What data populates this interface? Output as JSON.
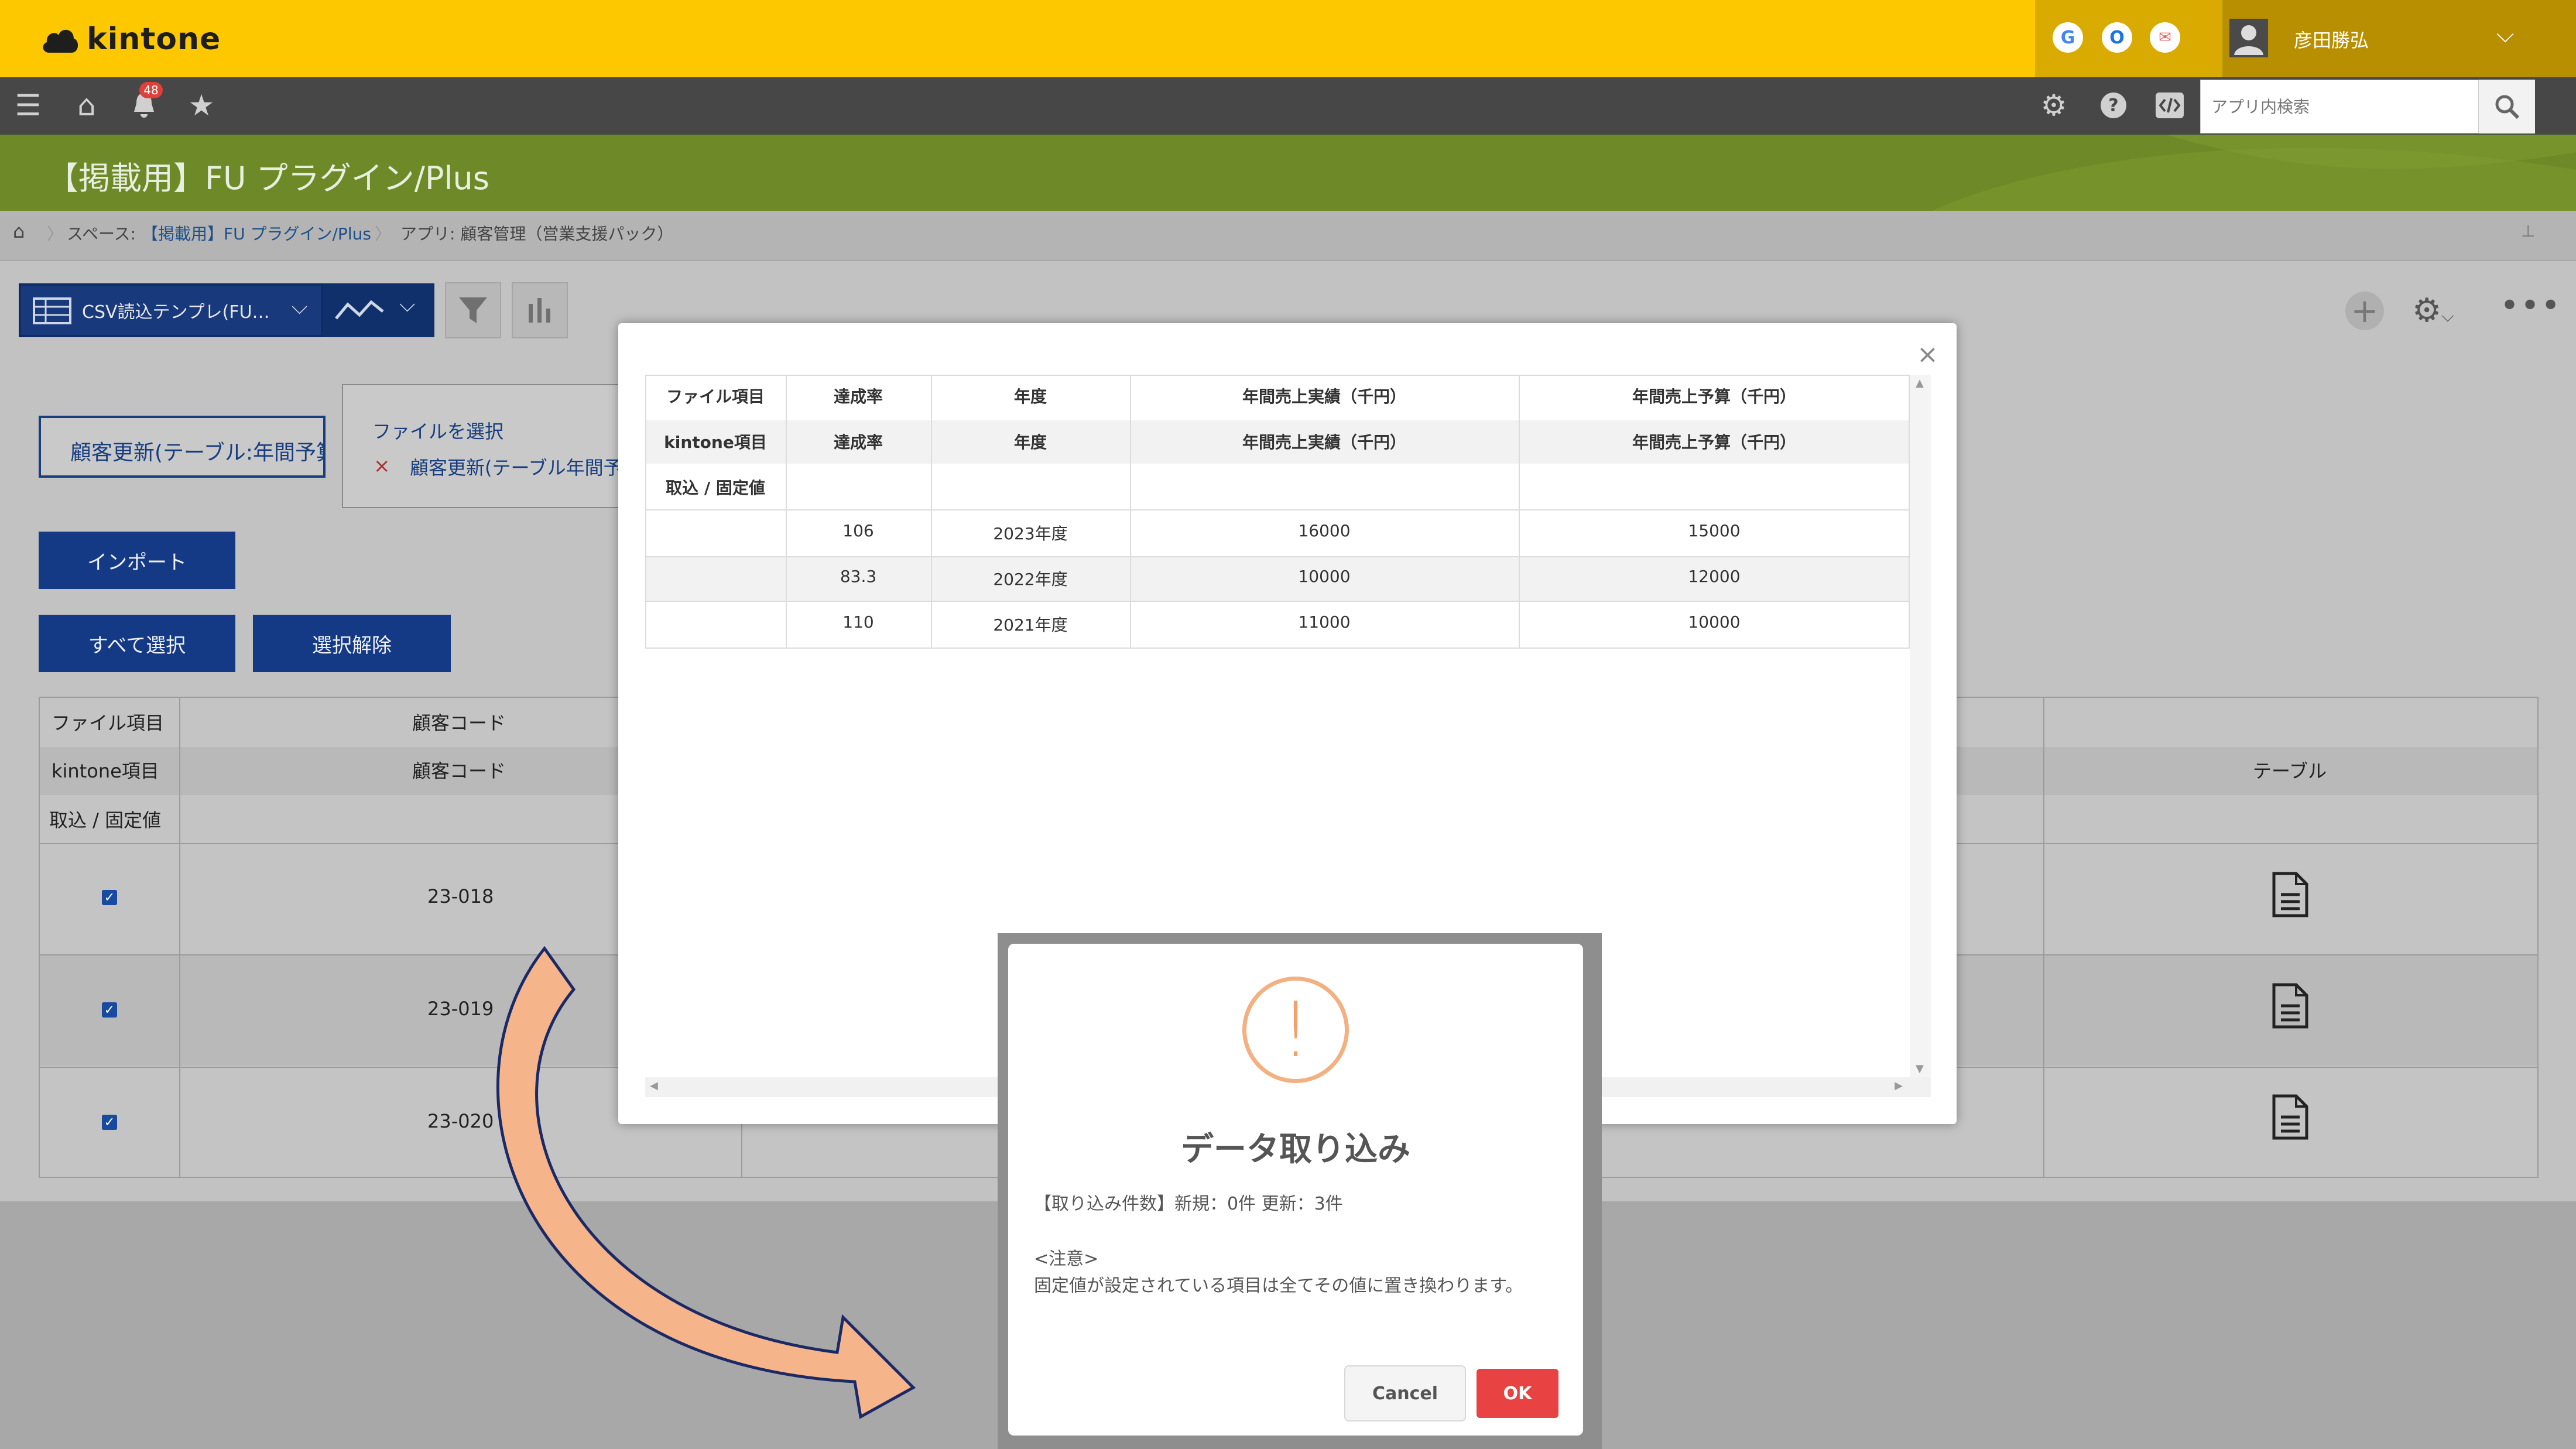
{
  "header": {
    "logo_text": "kintone",
    "user_name": "彦田勝弘",
    "notification_count": "48",
    "search_placeholder": "アプリ内検索",
    "service_icons": [
      "G",
      "O",
      "✉"
    ]
  },
  "space": {
    "title": "【掲載用】FU プラグイン/Plus"
  },
  "breadcrumb": {
    "space_prefix": "スペース:",
    "space_name": "【掲載用】FU プラグイン/Plus",
    "app": "アプリ: 顧客管理（営業支援パック）"
  },
  "toolbar": {
    "view_name": "CSV読込テンプレ(FU…"
  },
  "plugin": {
    "file_name_button": "顧客更新(テーブル:年間予算",
    "file_select_label": "ファイルを選択",
    "current_file": "顧客更新(テーブル年間予算",
    "import_button": "インポート",
    "select_all_button": "すべて選択",
    "deselect_button": "選択解除"
  },
  "bg_table": {
    "row_labels": [
      "ファイル項目",
      "kintone項目",
      "取込 / 固定値"
    ],
    "col1_file": "顧客コード",
    "col1_kintone": "顧客コード",
    "last_col_kintone": "テーブル",
    "rows": [
      {
        "code": "23-018",
        "checked": true
      },
      {
        "code": "23-019",
        "checked": true
      },
      {
        "code": "23-020",
        "checked": true
      }
    ]
  },
  "preview": {
    "close_icon": "×",
    "header_rows": [
      [
        "ファイル項目",
        "達成率",
        "年度",
        "年間売上実績（千円）",
        "年間売上予算（千円）"
      ],
      [
        "kintone項目",
        "達成率",
        "年度",
        "年間売上実績（千円）",
        "年間売上予算（千円）"
      ],
      [
        "取込 / 固定値",
        "",
        "",
        "",
        ""
      ]
    ],
    "data_rows": [
      [
        "",
        "106",
        "2023年度",
        "16000",
        "15000"
      ],
      [
        "",
        "83.3",
        "2022年度",
        "10000",
        "12000"
      ],
      [
        "",
        "110",
        "2021年度",
        "11000",
        "10000"
      ]
    ]
  },
  "dialog": {
    "icon": "!",
    "title": "データ取り込み",
    "count_text": "【取り込み件数】新規：0件 更新：3件",
    "note_title": "<注意>",
    "note_body": "固定値が設定されている項目は全てその値に置き換わります。",
    "cancel_label": "Cancel",
    "ok_label": "OK"
  },
  "colors": {
    "header_yellow": "#fdc800",
    "space_green": "#8db52f",
    "primary_blue": "#1f4fa8",
    "ok_red": "#e84242",
    "warning_orange": "#f3a06a",
    "arrow_fill": "#f5b48a"
  }
}
